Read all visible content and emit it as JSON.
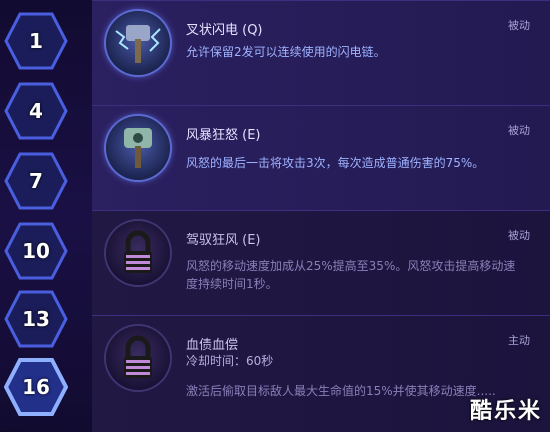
{
  "levels": [
    {
      "label": "1"
    },
    {
      "label": "4"
    },
    {
      "label": "7"
    },
    {
      "label": "10"
    },
    {
      "label": "13"
    },
    {
      "label": "16"
    }
  ],
  "talents": [
    {
      "title": "叉状闪电 (Q)",
      "tag": "被动",
      "desc": "允许保留2发可以连续使用的闪电链。",
      "icon": "lightning-hammer-icon",
      "locked": false
    },
    {
      "title": "风暴狂怒 (E)",
      "tag": "被动",
      "desc": "风怒的最后一击将攻击3次，每次造成普通伤害的75%。",
      "icon": "storm-hammer-icon",
      "locked": false
    },
    {
      "title": "驾驭狂风 (E)",
      "tag": "被动",
      "desc": "风怒的移动速度加成从25%提高至35%。风怒攻击提高移动速度持续时间1秒。",
      "icon": "lock-icon",
      "locked": true
    },
    {
      "title": "血债血偿",
      "tag": "主动",
      "cooldown": "冷却时间：60秒",
      "desc": "激活后偷取目标敌人最大生命值的15%并使其移动速度.....",
      "icon": "lock-icon",
      "locked": true
    }
  ],
  "watermark": "酷乐米",
  "colors": {
    "accent": "#6b7cff",
    "text": "#9fb3ff",
    "lock": "#c08ad8"
  }
}
